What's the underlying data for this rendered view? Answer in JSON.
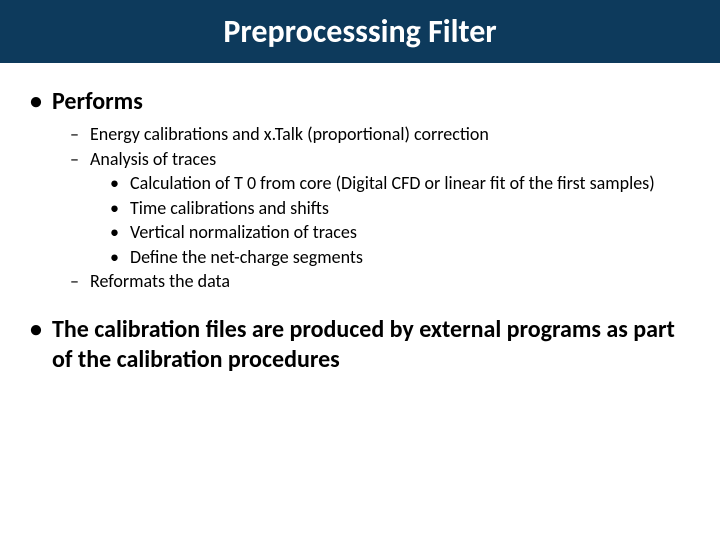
{
  "title": "Preprocesssing Filter",
  "section1": {
    "heading": "Performs",
    "items": [
      "Energy calibrations and x.Talk (proportional) correction",
      "Analysis of traces"
    ],
    "subitems": [
      "Calculation of T 0 from core (Digital CFD or linear fit of the first samples)",
      "Time calibrations and shifts",
      "Vertical normalization of traces",
      "Define the net-charge segments"
    ],
    "items_tail": [
      "Reformats the data"
    ]
  },
  "section2": {
    "heading": "The calibration files are produced by external programs as part of the calibration procedures"
  }
}
